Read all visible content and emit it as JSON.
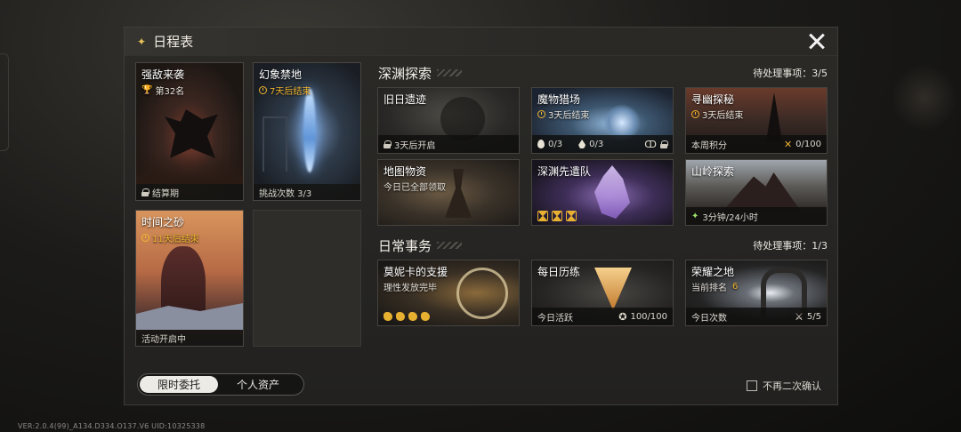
{
  "version_text": "VER:2.0.4(99)_A134.D334.O137.V6   UID:10325338",
  "panel": {
    "title": "日程表"
  },
  "left_cards": {
    "strong_enemy": {
      "name": "强敌来袭",
      "rank": "第32名",
      "footer": "结算期"
    },
    "phantom": {
      "name": "幻象禁地",
      "status": "7天后结束",
      "footer": "挑战次数 3/3"
    },
    "sand": {
      "name": "时间之砂",
      "status": "11天后结束",
      "footer": "活动开启中"
    }
  },
  "tabs": {
    "active": "限时委托",
    "inactive": "个人资产"
  },
  "confirm_label": "不再二次确认",
  "abyss": {
    "title": "深渊探索",
    "pending": "待处理事项：3/5",
    "cards": {
      "ruins": {
        "name": "旧日遗迹",
        "footer": "3天后开启"
      },
      "hunt": {
        "name": "魔物猎场",
        "status": "3天后结束",
        "a": "0/3",
        "b": "0/3"
      },
      "seek": {
        "name": "寻幽探秘",
        "status": "3天后结束",
        "footer": "本周积分",
        "value": "0/100"
      },
      "map": {
        "name": "地图物资",
        "sub": "今日已全部领取"
      },
      "vanguard": {
        "name": "深渊先遣队"
      },
      "mount": {
        "name": "山岭探索",
        "footer": "3分钟/24小时"
      }
    }
  },
  "daily": {
    "title": "日常事务",
    "pending": "待处理事项：1/3",
    "cards": {
      "monica": {
        "name": "莫妮卡的支援",
        "sub": "理性发放完毕"
      },
      "training": {
        "name": "每日历练",
        "footer": "今日活跃",
        "value": "100/100"
      },
      "glory": {
        "name": "荣耀之地",
        "sub_label": "当前排名",
        "sub_value": "6",
        "footer": "今日次数",
        "value": "5/5"
      }
    }
  }
}
